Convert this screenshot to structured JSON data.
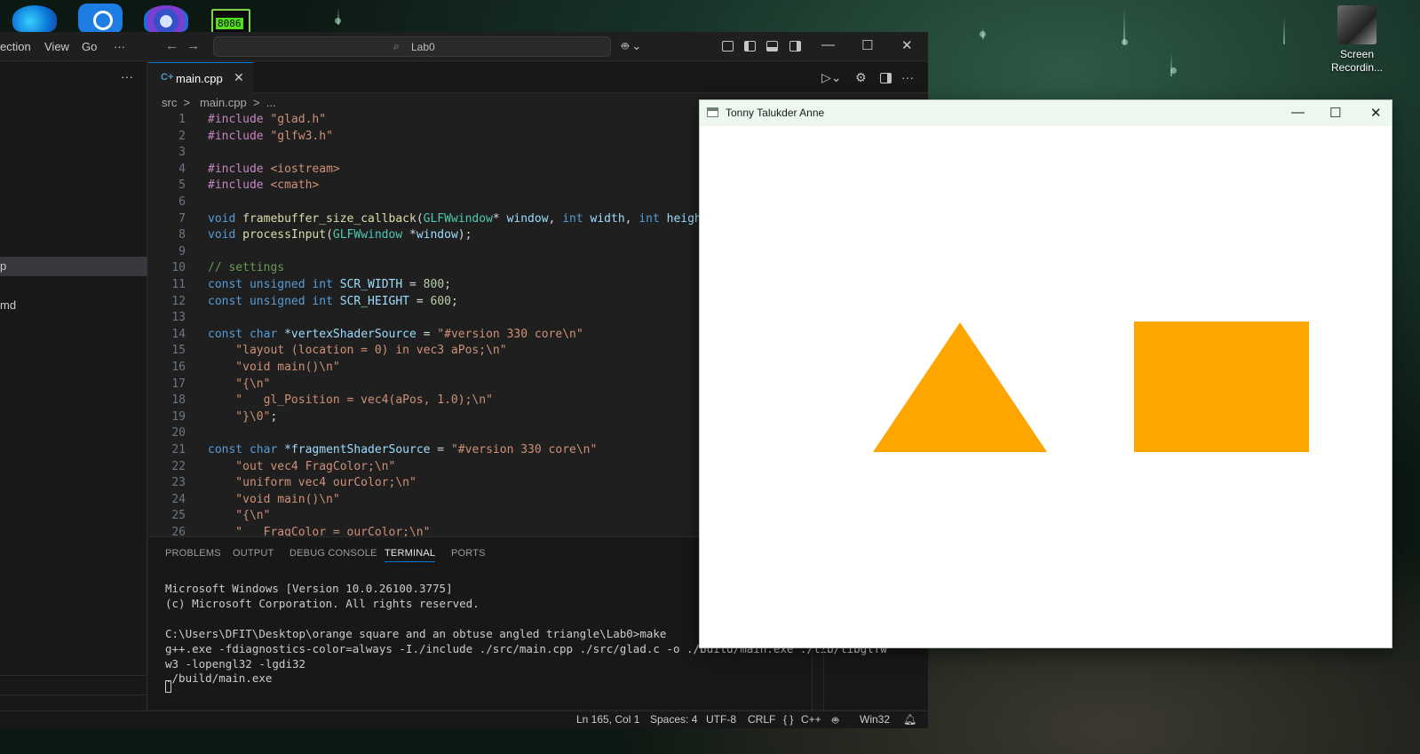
{
  "desktop": {
    "icons": [
      "edge-icon",
      "share-icon",
      "browser-icon",
      "emulator-icon"
    ],
    "emu_label": "8086",
    "screen_recording_label": "Screen Recordin..."
  },
  "vscode": {
    "menu": [
      "ection",
      "View",
      "Go",
      "···"
    ],
    "search_text": "Lab0",
    "sidebar": {
      "more": "···",
      "selected_item": "p",
      "item2": "md"
    },
    "tab": {
      "icon_text": "C+",
      "label": "main.cpp",
      "close": "✕"
    },
    "breadcrumb": "src  >   main.cpp  >  ...",
    "code_lines": [
      {
        "n": "1"
      },
      {
        "n": "2"
      },
      {
        "n": "3"
      },
      {
        "n": "4"
      },
      {
        "n": "5"
      },
      {
        "n": "6"
      },
      {
        "n": "7"
      },
      {
        "n": "8"
      },
      {
        "n": "9"
      },
      {
        "n": "10"
      },
      {
        "n": "11"
      },
      {
        "n": "12"
      },
      {
        "n": "13"
      },
      {
        "n": "14"
      },
      {
        "n": "15"
      },
      {
        "n": "16"
      },
      {
        "n": "17"
      },
      {
        "n": "18"
      },
      {
        "n": "19"
      },
      {
        "n": "20"
      },
      {
        "n": "21"
      },
      {
        "n": "22"
      },
      {
        "n": "23"
      },
      {
        "n": "24"
      },
      {
        "n": "25"
      },
      {
        "n": "26"
      }
    ],
    "code_tokens": {
      "l1": [
        "#include ",
        "\"glad.h\""
      ],
      "l2": [
        "#include ",
        "\"glfw3.h\""
      ],
      "l4": [
        "#include ",
        "<iostream>"
      ],
      "l5": [
        "#include ",
        "<cmath>"
      ],
      "l7": [
        "void ",
        "framebuffer_size_callback",
        "(",
        "GLFWwindow",
        "* ",
        "window",
        ", ",
        "int ",
        "width",
        ", ",
        "int ",
        "height",
        ")"
      ],
      "l8": [
        "void ",
        "processInput",
        "(",
        "GLFWwindow ",
        "*",
        "window",
        ");"
      ],
      "l10": [
        "// settings"
      ],
      "l11": [
        "const ",
        "unsigned ",
        "int ",
        "SCR_WIDTH",
        " = ",
        "800",
        ";"
      ],
      "l12": [
        "const ",
        "unsigned ",
        "int ",
        "SCR_HEIGHT",
        " = ",
        "600",
        ";"
      ],
      "l14": [
        "const ",
        "char ",
        "*vertexShaderSource",
        " = ",
        "\"#version 330 core\\n\""
      ],
      "l15": [
        "    \"layout (location = 0) in vec3 aPos;\\n\""
      ],
      "l16": [
        "    \"void main()\\n\""
      ],
      "l17": [
        "    \"{\\n\""
      ],
      "l18": [
        "    \"   gl_Position = vec4(aPos, 1.0);\\n\""
      ],
      "l19": [
        "    \"}\\0\"",
        ";"
      ],
      "l21": [
        "const ",
        "char ",
        "*fragmentShaderSource",
        " = ",
        "\"#version 330 core\\n\""
      ],
      "l22": [
        "    \"out vec4 FragColor;\\n\""
      ],
      "l23": [
        "    \"uniform vec4 ourColor;\\n\""
      ],
      "l24": [
        "    \"void main()\\n\""
      ],
      "l25": [
        "    \"{\\n\""
      ],
      "l26": [
        "    \"   FragColor = ourColor;\\n\""
      ]
    },
    "panel_tabs": [
      "PROBLEMS",
      "OUTPUT",
      "DEBUG CONSOLE",
      "TERMINAL",
      "PORTS"
    ],
    "active_panel_tab": "TERMINAL",
    "terminal_lines": [
      "Microsoft Windows [Version 10.0.26100.3775]",
      "(c) Microsoft Corporation. All rights reserved.",
      "",
      "C:\\Users\\DFIT\\Desktop\\orange square and an obtuse angled triangle\\Lab0>make",
      "g++.exe -fdiagnostics-color=always -I./include ./src/main.cpp ./src/glad.c -o ./build/main.exe ./lib/libglfw",
      "w3 -lopengl32 -lgdi32",
      "./build/main.exe"
    ],
    "status": {
      "position": "Ln 165, Col 1",
      "spaces": "Spaces: 4",
      "encoding": "UTF-8",
      "eol": "CRLF",
      "lang_braces": "{ }",
      "language": "C++",
      "platform": "Win32"
    }
  },
  "gl_window": {
    "title": "Tonny Talukder Anne",
    "shape_color": "#FFA500",
    "background": "#FFFFFF"
  }
}
